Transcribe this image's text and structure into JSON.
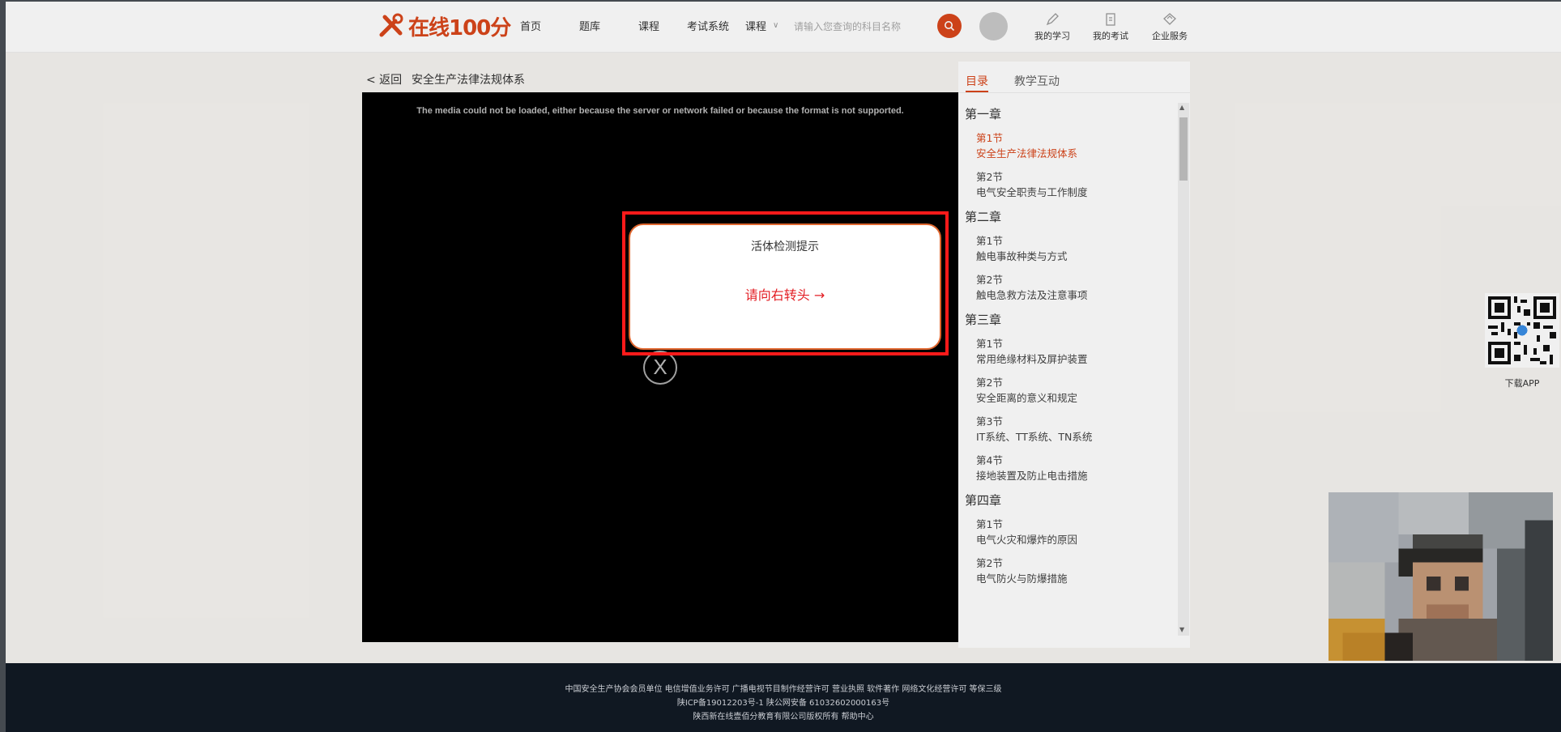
{
  "header": {
    "logo_text": "在线100分",
    "nav": [
      "首页",
      "题库",
      "课程",
      "考试系统"
    ],
    "search_select": "课程",
    "search_placeholder": "请输入您查询的科目名称",
    "icons": [
      {
        "label": "我的学习",
        "icon": "pencil-icon"
      },
      {
        "label": "我的考试",
        "icon": "exam-icon"
      },
      {
        "label": "企业服务",
        "icon": "enterprise-icon"
      }
    ]
  },
  "course": {
    "back_label": "< 返回",
    "title": "安全生产法律法规体系",
    "media_error": "The media could not be loaded, either because the server or network failed or because the format is not supported.",
    "close_glyph": "X"
  },
  "dialog": {
    "title": "活体检测提示",
    "message": "请向右转头 →"
  },
  "sidebar": {
    "tab_active": "目录",
    "tab_other": "教学互动",
    "chapters": [
      {
        "title": "第一章",
        "sections": [
          {
            "num": "第1节",
            "name": "安全生产法律法规体系",
            "active": true
          },
          {
            "num": "第2节",
            "name": "电气安全职责与工作制度"
          }
        ]
      },
      {
        "title": "第二章",
        "sections": [
          {
            "num": "第1节",
            "name": "触电事故种类与方式"
          },
          {
            "num": "第2节",
            "name": "触电急救方法及注意事项"
          }
        ]
      },
      {
        "title": "第三章",
        "sections": [
          {
            "num": "第1节",
            "name": "常用绝缘材料及屏护装置"
          },
          {
            "num": "第2节",
            "name": "安全距离的意义和规定"
          },
          {
            "num": "第3节",
            "name": "IT系统、TT系统、TN系统"
          },
          {
            "num": "第4节",
            "name": "接地装置及防止电击措施"
          }
        ]
      },
      {
        "title": "第四章",
        "sections": [
          {
            "num": "第1节",
            "name": "电气火灾和爆炸的原因"
          },
          {
            "num": "第2节",
            "name": "电气防火与防爆措施"
          }
        ]
      }
    ]
  },
  "qr": {
    "label": "下载APP"
  },
  "footer": {
    "line1": "中国安全生产协会会员单位  电信增值业务许可  广播电视节目制作经营许可  营业执照  软件著作  网络文化经营许可  等保三级",
    "line2": "陕ICP备19012203号-1  陕公网安备 61032602000163号",
    "line3": "陕西新在线壹佰分教育有限公司版权所有   帮助中心"
  },
  "colors": {
    "accent": "#d9471b",
    "alert": "#e31e24",
    "footer_bg": "#101822"
  }
}
